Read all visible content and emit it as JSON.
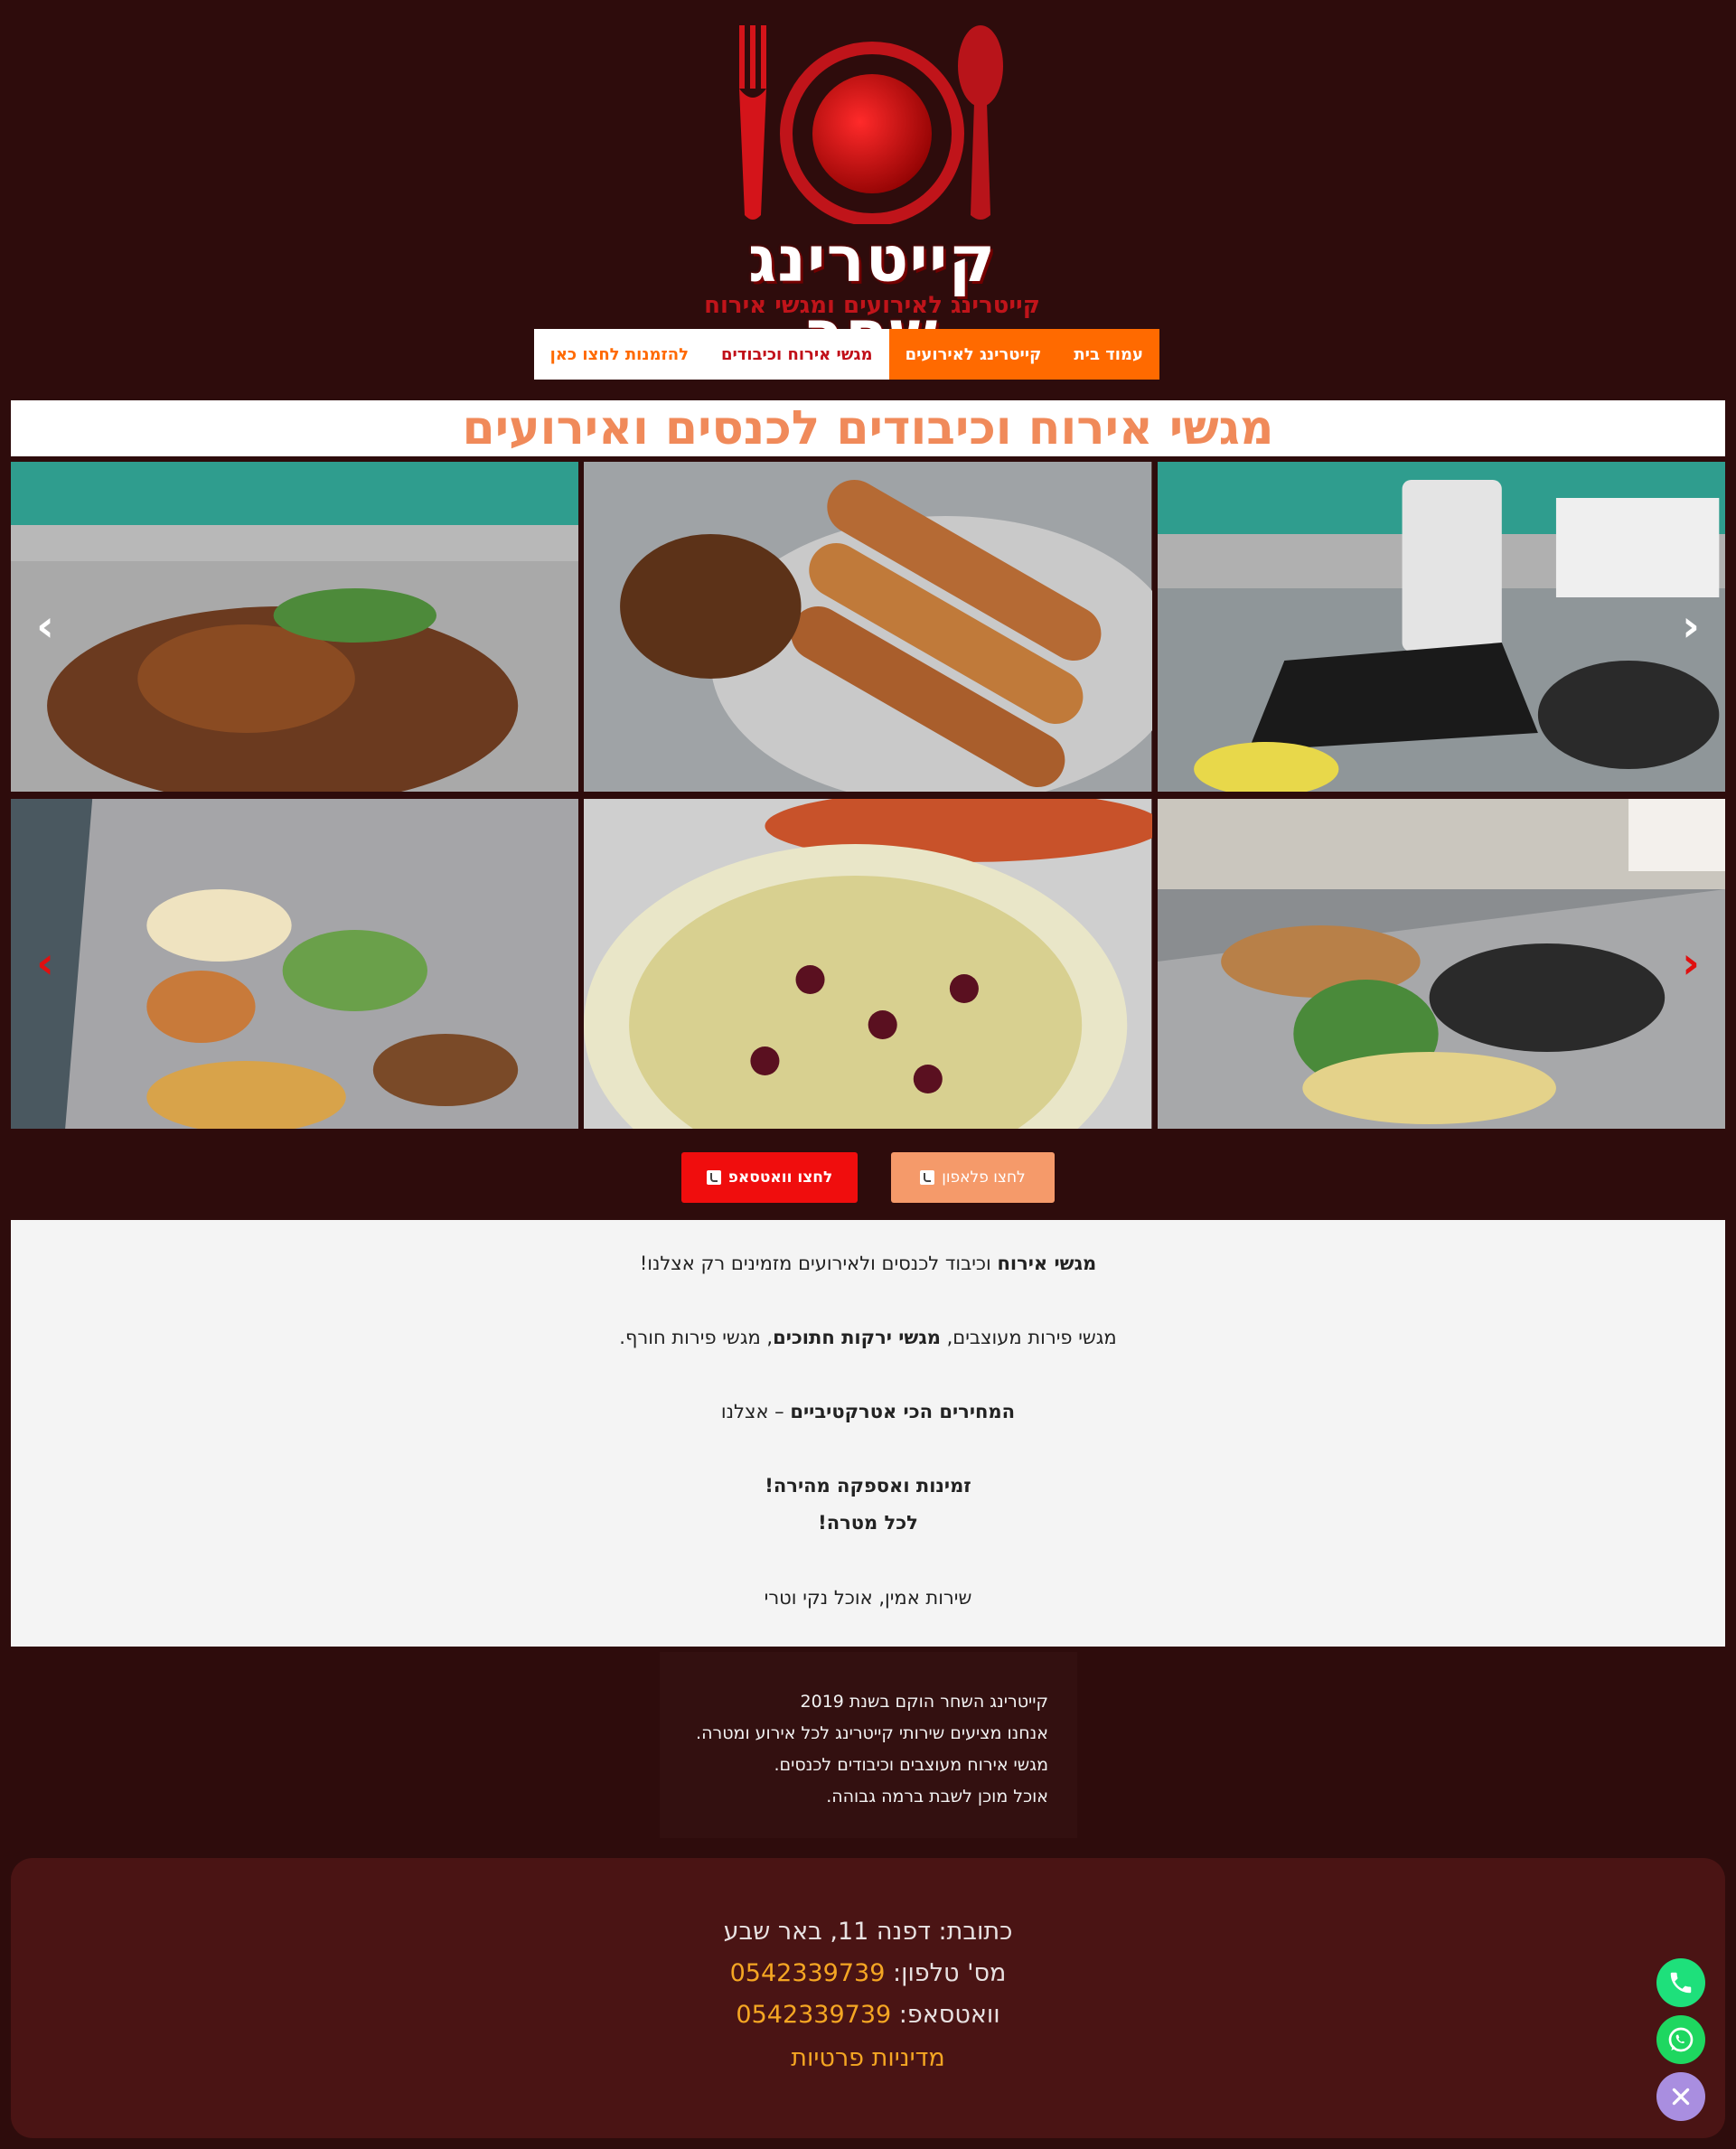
{
  "brand": {
    "logo_title": "קייטרינג שחר",
    "logo_subtitle": "קייטרינג לאירועים ומגשי אירוח"
  },
  "nav": {
    "items": [
      {
        "label": "עמוד בית",
        "style": "orange"
      },
      {
        "label": "קייטרינג לאירועים",
        "style": "orange"
      },
      {
        "label": "מגשי אירוח וכיבודים",
        "style": "white"
      },
      {
        "label": "להזמנות לחצו כאן",
        "style": "white-order"
      }
    ]
  },
  "hero": {
    "heading": "מגשי אירוח וכיבודים לכנסים ואירועים"
  },
  "cta": {
    "whatsapp_label": "לחצו וואטסאפ",
    "phone_label": "לחצו פלאפון"
  },
  "content": {
    "line1_bold": "מגשי אירוח",
    "line1_rest": " וכיבוד לכנסים ולאירועים מזמינים רק אצלנו!",
    "line2_start": "מגשי פירות מעוצבים, ",
    "line2_bold": "מגשי ירקות חתוכים",
    "line2_end": ", מגשי פירות חורף.",
    "line3_bold": "המחירים הכי אטרקטיביים",
    "line3_rest": " – אצלנו",
    "line4_bold": "זמינות ואספקה מהירה!",
    "line5_bold": "לכל מטרה!",
    "line6": "שירות אמין, אוכל נקי וטרי"
  },
  "about": {
    "lines": [
      "קייטרינג השחר הוקם בשנת 2019",
      "אנחנו מציעים שירותי קייטרינג לכל אירוע ומטרה.",
      "מגשי אירוח מעוצבים וכיבודים לכנסים.",
      "אוכל מוכן לשבת ברמה גבוהה."
    ]
  },
  "footer": {
    "address_label": "כתובת: דפנה 11, באר שבע",
    "phone_label": "מס' טלפון: ",
    "phone_value": "0542339739",
    "whatsapp_label": "וואטסאפ: ",
    "whatsapp_value": "0542339739",
    "privacy_link": "מדיניות פרטיות"
  },
  "colors": {
    "background": "#2e0c0c",
    "nav_orange": "#ff6a00",
    "heading_peach": "#f08a5a",
    "accent": "#f5a623",
    "whatsapp_red": "#f00d0d"
  }
}
